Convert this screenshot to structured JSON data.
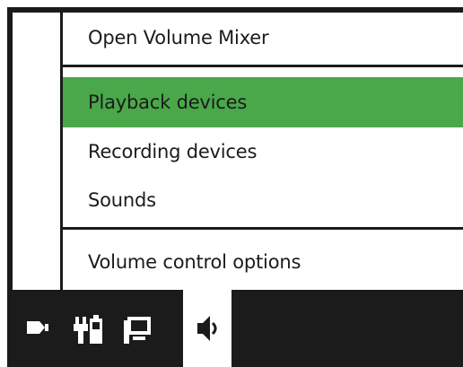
{
  "context_menu": {
    "items": [
      {
        "label": "Open Volume Mixer"
      },
      {
        "label": "Playback devices",
        "selected": true
      },
      {
        "label": "Recording devices"
      },
      {
        "label": "Sounds"
      },
      {
        "label": "Volume control options"
      }
    ],
    "highlight_color": "#4aa84a"
  },
  "taskbar": {
    "tray_icons": [
      "flag-icon",
      "battery-plug-icon",
      "network-icon",
      "speaker-icon"
    ],
    "background": "#1b1b1b"
  }
}
